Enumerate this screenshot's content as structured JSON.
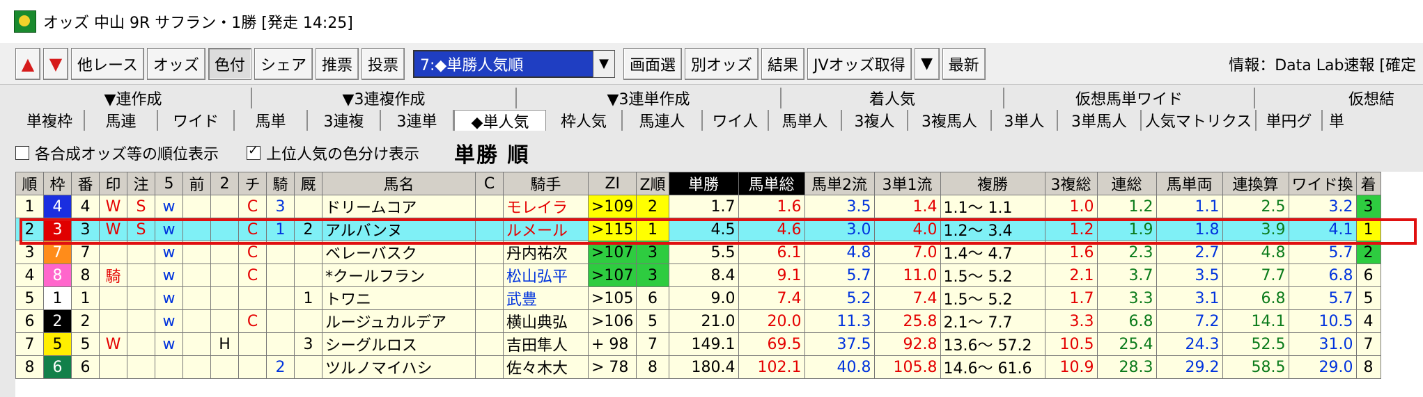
{
  "window": {
    "title": "オッズ 中山 9R サフラン・1勝 [発走 14:25]"
  },
  "toolbar": {
    "buttons": [
      "他レース",
      "オッズ",
      "色付",
      "シェア",
      "推票",
      "投票"
    ],
    "select_value": "7:◆単勝人気順",
    "right_buttons": [
      "画面選",
      "別オッズ",
      "結果",
      "JVオッズ取得",
      "最新"
    ],
    "info": "情報：Data Lab速報 [確定"
  },
  "tabs_top": [
    "▼連作成",
    "▼3連複作成",
    "▼3連単作成",
    "着人気",
    "仮想馬単ワイド",
    "仮想結"
  ],
  "tabs_bottom": [
    "単複枠",
    "馬連",
    "ワイド",
    "馬単",
    "3連複",
    "3連単",
    "◆単人気",
    "枠人気",
    "馬連人",
    "ワイ人",
    "馬単人",
    "3複人",
    "3複馬人",
    "3単人",
    "3単馬人",
    "人気マトリクス",
    "単円グ",
    "単"
  ],
  "options": {
    "rank_display": "各合成オッズ等の順位表示",
    "color_split": "上位人気の色分け表示",
    "section_title": "単勝 順"
  },
  "table": {
    "headers": [
      "順",
      "枠",
      "番",
      "印",
      "注",
      "5",
      "前",
      "2",
      "チ",
      "騎",
      "厩",
      "馬名",
      "C",
      "騎手",
      "ZI",
      "Z順",
      "単勝",
      "馬単総",
      "馬単2流",
      "3単1流",
      "複勝",
      "3複総",
      "連総",
      "馬単両",
      "連換算",
      "ワイド換",
      "着"
    ],
    "rows": [
      [
        "1",
        "4",
        "4",
        "W",
        "S",
        "w",
        "",
        "",
        "C",
        "3",
        "",
        "ドリームコア",
        "",
        "モレイラ",
        ">109",
        "2",
        "1.7",
        "1.6",
        "3.5",
        "1.4",
        "1.1～ 1.1",
        "1.0",
        "1.2",
        "1.1",
        "2.5",
        "3.2",
        "3"
      ],
      [
        "2",
        "3",
        "3",
        "W",
        "S",
        "w",
        "",
        "",
        "C",
        "1",
        "2",
        "アルバンヌ",
        "",
        "ルメール",
        ">115",
        "1",
        "4.5",
        "4.6",
        "3.0",
        "4.0",
        "1.2～ 3.4",
        "1.2",
        "1.9",
        "1.8",
        "3.9",
        "4.1",
        "1"
      ],
      [
        "3",
        "7",
        "7",
        "",
        "",
        "w",
        "",
        "",
        "C",
        "",
        "",
        "ベレーバスク",
        "",
        "丹内祐次",
        ">107",
        "3",
        "5.5",
        "6.1",
        "4.8",
        "7.0",
        "1.4～ 4.7",
        "1.6",
        "2.3",
        "2.7",
        "4.8",
        "5.7",
        "2"
      ],
      [
        "4",
        "8",
        "8",
        "騎",
        "",
        "w",
        "",
        "",
        "C",
        "",
        "",
        "*クールフラン",
        "",
        "松山弘平",
        ">107",
        "3",
        "8.4",
        "9.1",
        "5.7",
        "11.0",
        "1.5～ 5.2",
        "2.1",
        "3.7",
        "3.5",
        "7.7",
        "6.8",
        "6"
      ],
      [
        "5",
        "1",
        "1",
        "",
        "",
        "w",
        "",
        "",
        "",
        "",
        "1",
        "トワニ",
        "",
        "武豊",
        ">105",
        "6",
        "9.0",
        "7.4",
        "5.2",
        "7.4",
        "1.5～ 5.2",
        "1.7",
        "3.3",
        "3.1",
        "6.8",
        "5.7",
        "5"
      ],
      [
        "6",
        "2",
        "2",
        "",
        "",
        "w",
        "",
        "",
        "C",
        "",
        "",
        "ルージュカルデア",
        "",
        "横山典弘",
        ">106",
        "5",
        "21.0",
        "20.0",
        "11.3",
        "25.8",
        "2.1～ 7.7",
        "3.3",
        "6.8",
        "7.2",
        "14.1",
        "10.5",
        "4"
      ],
      [
        "7",
        "5",
        "5",
        "W",
        "",
        "w",
        "",
        "H",
        "",
        "",
        "3",
        "シーグルロス",
        "",
        "吉田隼人",
        "+ 98",
        "7",
        "149.1",
        "69.5",
        "37.5",
        "92.8",
        "13.6～ 57.2",
        "10.5",
        "25.4",
        "24.3",
        "52.5",
        "31.0",
        "7"
      ],
      [
        "8",
        "6",
        "6",
        "",
        "",
        "",
        "",
        "",
        "",
        "2",
        "",
        "ツルノマイハシ",
        "",
        "佐々木大",
        "> 78",
        "8",
        "180.4",
        "102.1",
        "40.8",
        "105.8",
        "14.6～ 61.6",
        "10.9",
        "28.3",
        "29.2",
        "58.5",
        "29.0",
        "8"
      ]
    ]
  },
  "colors": {
    "waku": {
      "1": "#ffffff",
      "2": "#000000",
      "3": "#e00000",
      "4": "#1a2ee0",
      "5": "#ffee00",
      "6": "#12804a",
      "7": "#ff8c1a",
      "8": "#ff66cc"
    },
    "highlight_row": "#7ff0f6",
    "cell_bg": "#ffffe1",
    "selection_border": "#e01010"
  }
}
